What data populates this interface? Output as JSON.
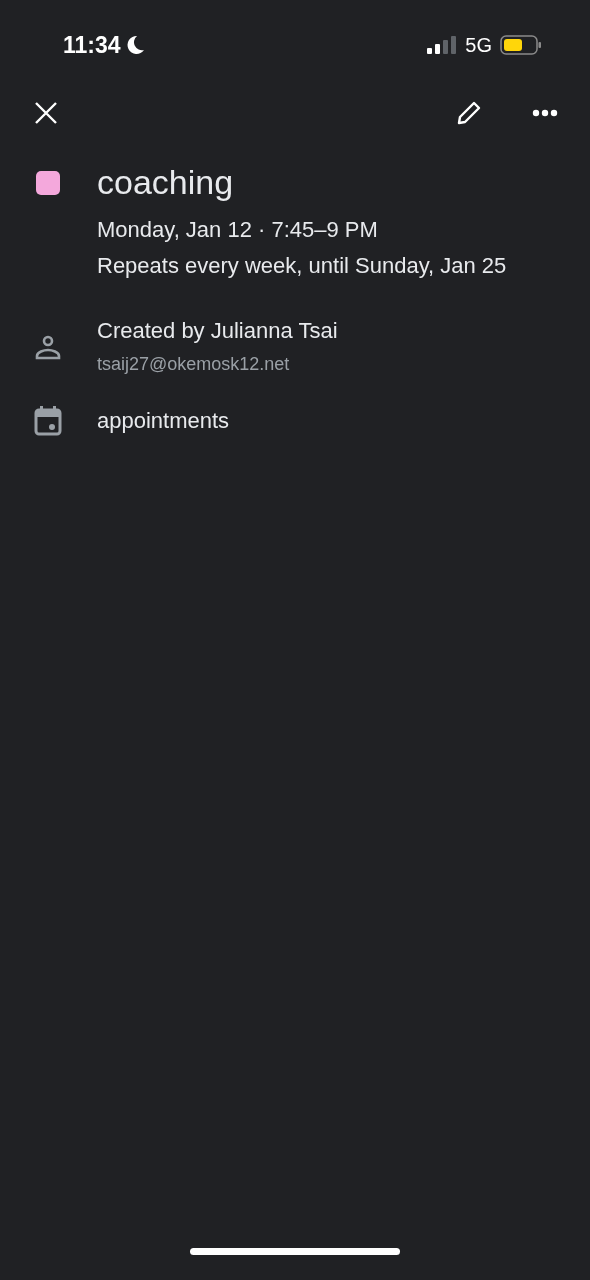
{
  "status_bar": {
    "time": "11:34",
    "network": "5G"
  },
  "event": {
    "title": "coaching",
    "when": "Monday, Jan 12 · 7:45–9 PM",
    "repeat": "Repeats every week, until Sunday, Jan 25"
  },
  "creator": {
    "label": "Created by Julianna Tsai",
    "email": "tsaij27@okemosk12.net"
  },
  "calendar": {
    "name": "appointments"
  }
}
